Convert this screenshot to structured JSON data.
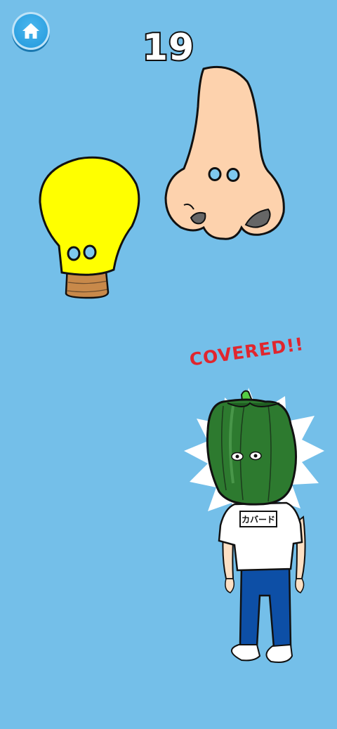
{
  "hud": {
    "score": "19",
    "home_icon": "home-icon"
  },
  "items": {
    "lightbulb": {
      "icon": "lightbulb-icon",
      "color": "#ffff00"
    },
    "nose": {
      "icon": "nose-icon",
      "color": "#fdd2ad"
    }
  },
  "character": {
    "status_text": "COVERED!!",
    "shirt_text": "カバード",
    "head": "green-bell-pepper",
    "pepper_color": "#2d7a2f"
  },
  "colors": {
    "background": "#74bfe9",
    "accent_red": "#e0262e"
  }
}
